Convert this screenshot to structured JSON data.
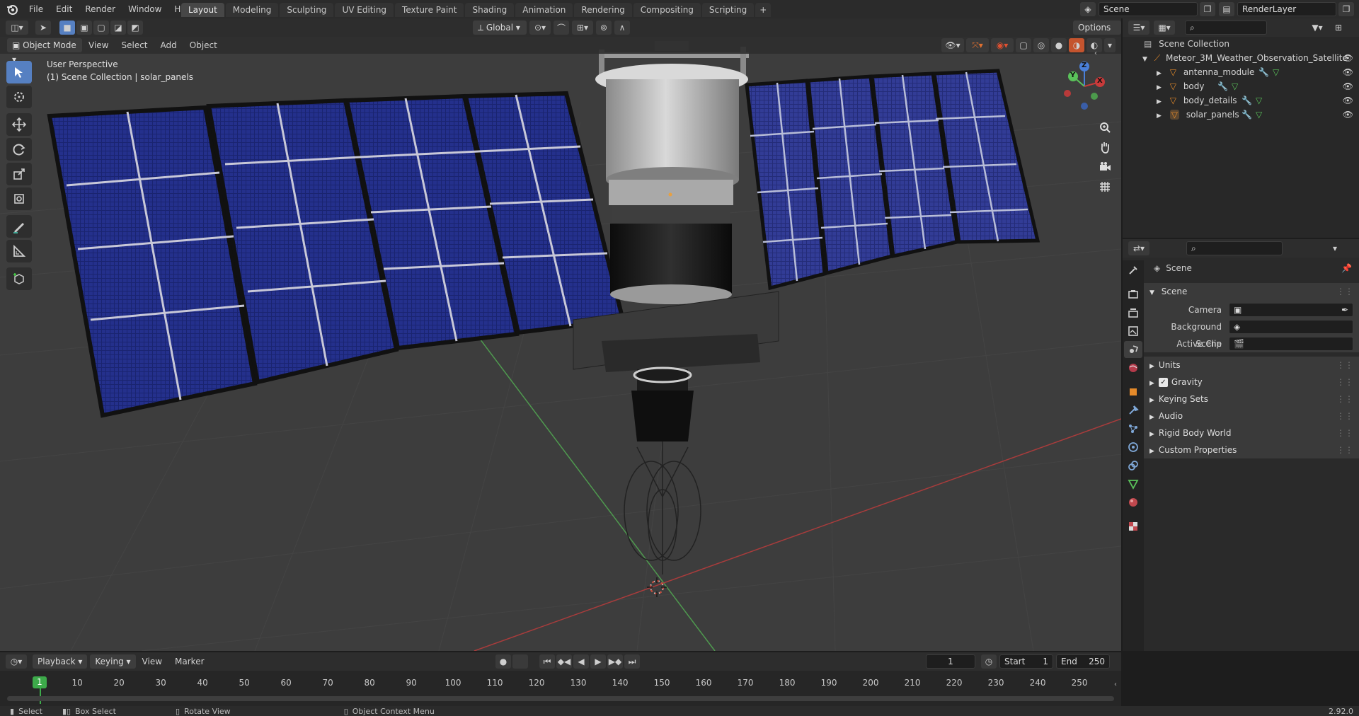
{
  "topbar": {
    "menus": [
      "File",
      "Edit",
      "Render",
      "Window",
      "Help"
    ],
    "workspaces": [
      "Layout",
      "Modeling",
      "Sculpting",
      "UV Editing",
      "Texture Paint",
      "Shading",
      "Animation",
      "Rendering",
      "Compositing",
      "Scripting"
    ],
    "active_workspace": "Layout",
    "add_tab": "+",
    "scene_name": "Scene",
    "render_layer": "RenderLayer"
  },
  "viewport_header": {
    "mode": "Object Mode",
    "menus": [
      "View",
      "Select",
      "Add",
      "Object"
    ],
    "transform_orientation": "Global",
    "options": "Options"
  },
  "viewport": {
    "view_name": "User Perspective",
    "context": "(1) Scene Collection | solar_panels",
    "gizmo_axes": [
      "X",
      "Y",
      "Z"
    ]
  },
  "outliner": {
    "root": "Scene Collection",
    "collection": "Meteor_3M_Weather_Observation_Satellite",
    "objects": [
      "antenna_module",
      "body",
      "body_details",
      "solar_panels"
    ]
  },
  "properties": {
    "header": "Scene",
    "panel": "Scene",
    "fields": [
      {
        "label": "Camera",
        "value": ""
      },
      {
        "label": "Background Scene",
        "value": ""
      },
      {
        "label": "Active Clip",
        "value": ""
      }
    ],
    "sections": [
      "Units",
      "Gravity",
      "Keying Sets",
      "Audio",
      "Rigid Body World",
      "Custom Properties"
    ],
    "gravity_checked": true
  },
  "timeline": {
    "menus": [
      "Playback",
      "Keying",
      "View",
      "Marker"
    ],
    "current_frame": "1",
    "start_label": "Start",
    "start": "1",
    "end_label": "End",
    "end": "250",
    "ticks": [
      "1",
      "10",
      "20",
      "30",
      "40",
      "50",
      "60",
      "70",
      "80",
      "90",
      "100",
      "110",
      "120",
      "130",
      "140",
      "150",
      "160",
      "170",
      "180",
      "190",
      "200",
      "210",
      "220",
      "230",
      "240",
      "250"
    ]
  },
  "statusbar": {
    "items": [
      "Select",
      "Box Select",
      "Rotate View",
      "Object Context Menu"
    ],
    "version": "2.92.0"
  },
  "colors": {
    "accent": "#5680c2",
    "active_frame": "#3daa4a",
    "x_axis": "#c83a3a",
    "y_axis": "#5ac25a",
    "z_axis": "#4a7fd8",
    "object_icon": "#e58a2a"
  }
}
